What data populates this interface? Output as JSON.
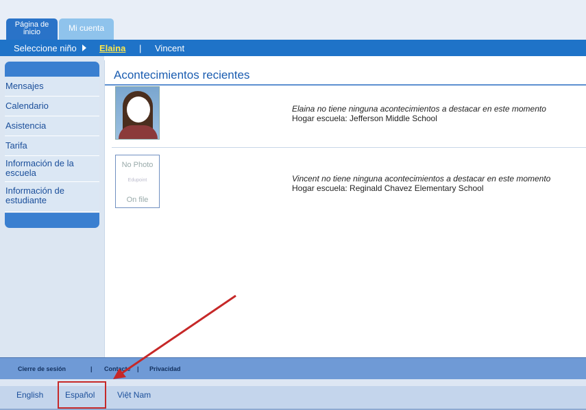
{
  "tabs": {
    "home": "Página de inicio",
    "account": "Mi cuenta"
  },
  "child_selector": {
    "label": "Seleccione niño",
    "children": [
      "Elaina",
      "Vincent"
    ],
    "separator": "|",
    "active": "Elaina"
  },
  "sidebar": {
    "items": [
      {
        "label": "Mensajes"
      },
      {
        "label": "Calendario"
      },
      {
        "label": "Asistencia"
      },
      {
        "label": "Tarifa"
      },
      {
        "label": "Información de la escuela"
      },
      {
        "label": "Información de estudiante"
      }
    ]
  },
  "main": {
    "title": "Acontecimientos recientes",
    "events": [
      {
        "message": "Elaina no tiene ninguna acontecimientos a destacar en este momento",
        "school": "Hogar escuela: Jefferson Middle School"
      },
      {
        "message": "Vincent no tiene ninguna acontecimientos a destacar en este momento",
        "school": "Hogar escuela: Reginald Chavez Elementary School"
      }
    ],
    "no_photo": {
      "line1": "No Photo",
      "brand": "Edupoint",
      "line2": "On file"
    }
  },
  "footer": {
    "logout": "Cierre de sesión",
    "contact": "Contacte",
    "privacy": "Privacidad",
    "separator": "|"
  },
  "languages": [
    "English",
    "Español",
    "Việt Nam"
  ],
  "annotation": {
    "color": "#c62828",
    "highlighted": "Español"
  },
  "colors": {
    "primary_blue": "#1f73c8",
    "active_child": "#ffe84a",
    "link_blue": "#1a4e9a"
  }
}
